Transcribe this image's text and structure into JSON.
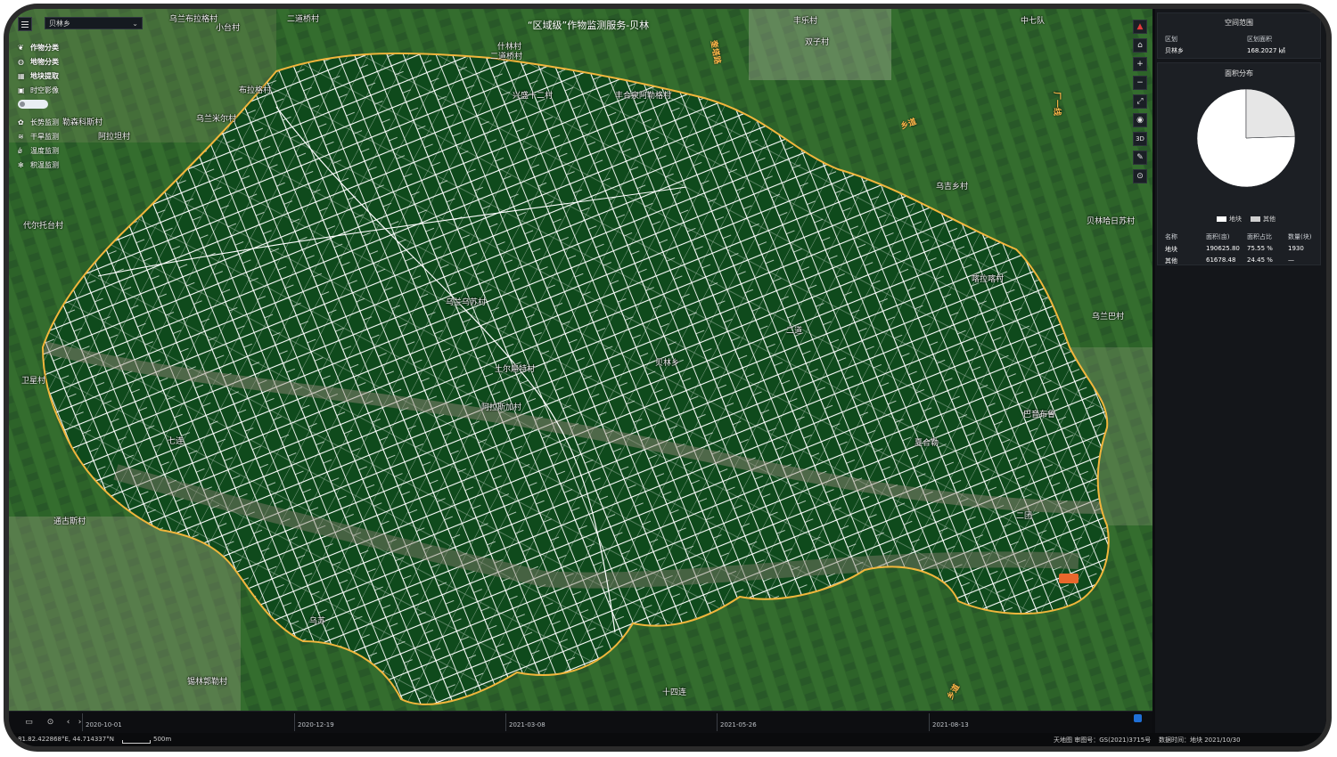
{
  "title": "“区域级”作物监测服务-贝林",
  "region_select": {
    "value": "贝林乡"
  },
  "sidebar": {
    "categories": [
      {
        "icon": "leaf-icon",
        "label": "作物分类"
      },
      {
        "icon": "globe-icon",
        "label": "地物分类"
      },
      {
        "icon": "grid-icon",
        "label": "地块提取"
      },
      {
        "icon": "image-icon",
        "label": "时空影像"
      }
    ],
    "monitors": [
      {
        "icon": "sprout-icon",
        "label": "长势监测"
      },
      {
        "icon": "drought-icon",
        "label": "干旱监测"
      },
      {
        "icon": "thermometer-icon",
        "label": "温度监测"
      },
      {
        "icon": "snowflake-icon",
        "label": "积温监测"
      }
    ]
  },
  "toolbar": [
    {
      "name": "compass-icon",
      "glyph": "▲"
    },
    {
      "name": "home-icon",
      "glyph": "⌂"
    },
    {
      "name": "zoom-in-icon",
      "glyph": "+"
    },
    {
      "name": "zoom-out-icon",
      "glyph": "−"
    },
    {
      "name": "fullscreen-icon",
      "glyph": "⤢"
    },
    {
      "name": "layer-hide-icon",
      "glyph": "◉"
    },
    {
      "name": "3d-icon",
      "glyph": "3D"
    },
    {
      "name": "measure-icon",
      "glyph": "✎"
    },
    {
      "name": "locate-icon",
      "glyph": "⊙"
    }
  ],
  "map_labels": [
    {
      "text": "乌兰布拉格村"
    },
    {
      "text": "二道桥村"
    },
    {
      "text": "小台村"
    },
    {
      "text": "中七队"
    },
    {
      "text": "丰乐村"
    },
    {
      "text": "双子村"
    },
    {
      "text": "什林村"
    },
    {
      "text": "二道桥村"
    },
    {
      "text": "丰合泉阿勒格村"
    },
    {
      "text": "兴盛十二村"
    },
    {
      "text": "布拉格村"
    },
    {
      "text": "勒森科斯村"
    },
    {
      "text": "乌兰米尔村"
    },
    {
      "text": "阿拉坦村"
    },
    {
      "text": "代尔托台村"
    },
    {
      "text": "喀拉喀村"
    },
    {
      "text": "乌吉乡村"
    },
    {
      "text": "贝林哈日苏村"
    },
    {
      "text": "乌兰巴村"
    },
    {
      "text": "土尔扈特村"
    },
    {
      "text": "阿拉斯加村"
    },
    {
      "text": "乌兰乌苏村"
    },
    {
      "text": "二道"
    },
    {
      "text": "贝林乡"
    },
    {
      "text": "巴音布鲁"
    },
    {
      "text": "夏合勒"
    },
    {
      "text": "通古斯村"
    },
    {
      "text": "十四连"
    },
    {
      "text": "锡林郭勒村"
    },
    {
      "text": "七连"
    },
    {
      "text": "二团"
    },
    {
      "text": "乌苏"
    },
    {
      "text": "卫星村"
    }
  ],
  "road_labels": [
    {
      "text": "奎塔路"
    },
    {
      "text": "乡道"
    },
    {
      "text": "厂一线"
    },
    {
      "text": "乡道"
    }
  ],
  "panel": {
    "spatial_title": "空间范围",
    "spatial_headers": [
      "区划",
      "区划面积"
    ],
    "spatial_values": [
      "贝林乡",
      "168.2027 ㎢"
    ],
    "dist_title": "面积分布",
    "legend": [
      {
        "label": "地块",
        "color": "#ffffff"
      },
      {
        "label": "其他",
        "color": "#cfcfcf"
      }
    ],
    "table_headers": [
      "名称",
      "面积(亩)",
      "面积占比",
      "数量(块)"
    ],
    "table_rows": [
      [
        "地块",
        "190625.80",
        "75.55 %",
        "1930"
      ],
      [
        "其他",
        "61678.48",
        "24.45 %",
        "—"
      ]
    ]
  },
  "chart_data": {
    "type": "pie",
    "categories": [
      "地块",
      "其他"
    ],
    "values": [
      75.55,
      24.45
    ],
    "colors": [
      "#ffffff",
      "#e6e6e6"
    ]
  },
  "timeline": {
    "dates": [
      "2020-10-01",
      "2020-12-19",
      "2021-03-08",
      "2021-05-26",
      "2021-08-13"
    ]
  },
  "status": {
    "coords": "81.82.422868°E, 44.714337°N",
    "scale": "500m",
    "attribution": "天地图 审图号：GS(2021)3715号",
    "data_time": "数据时间：地块 2021/10/30"
  }
}
